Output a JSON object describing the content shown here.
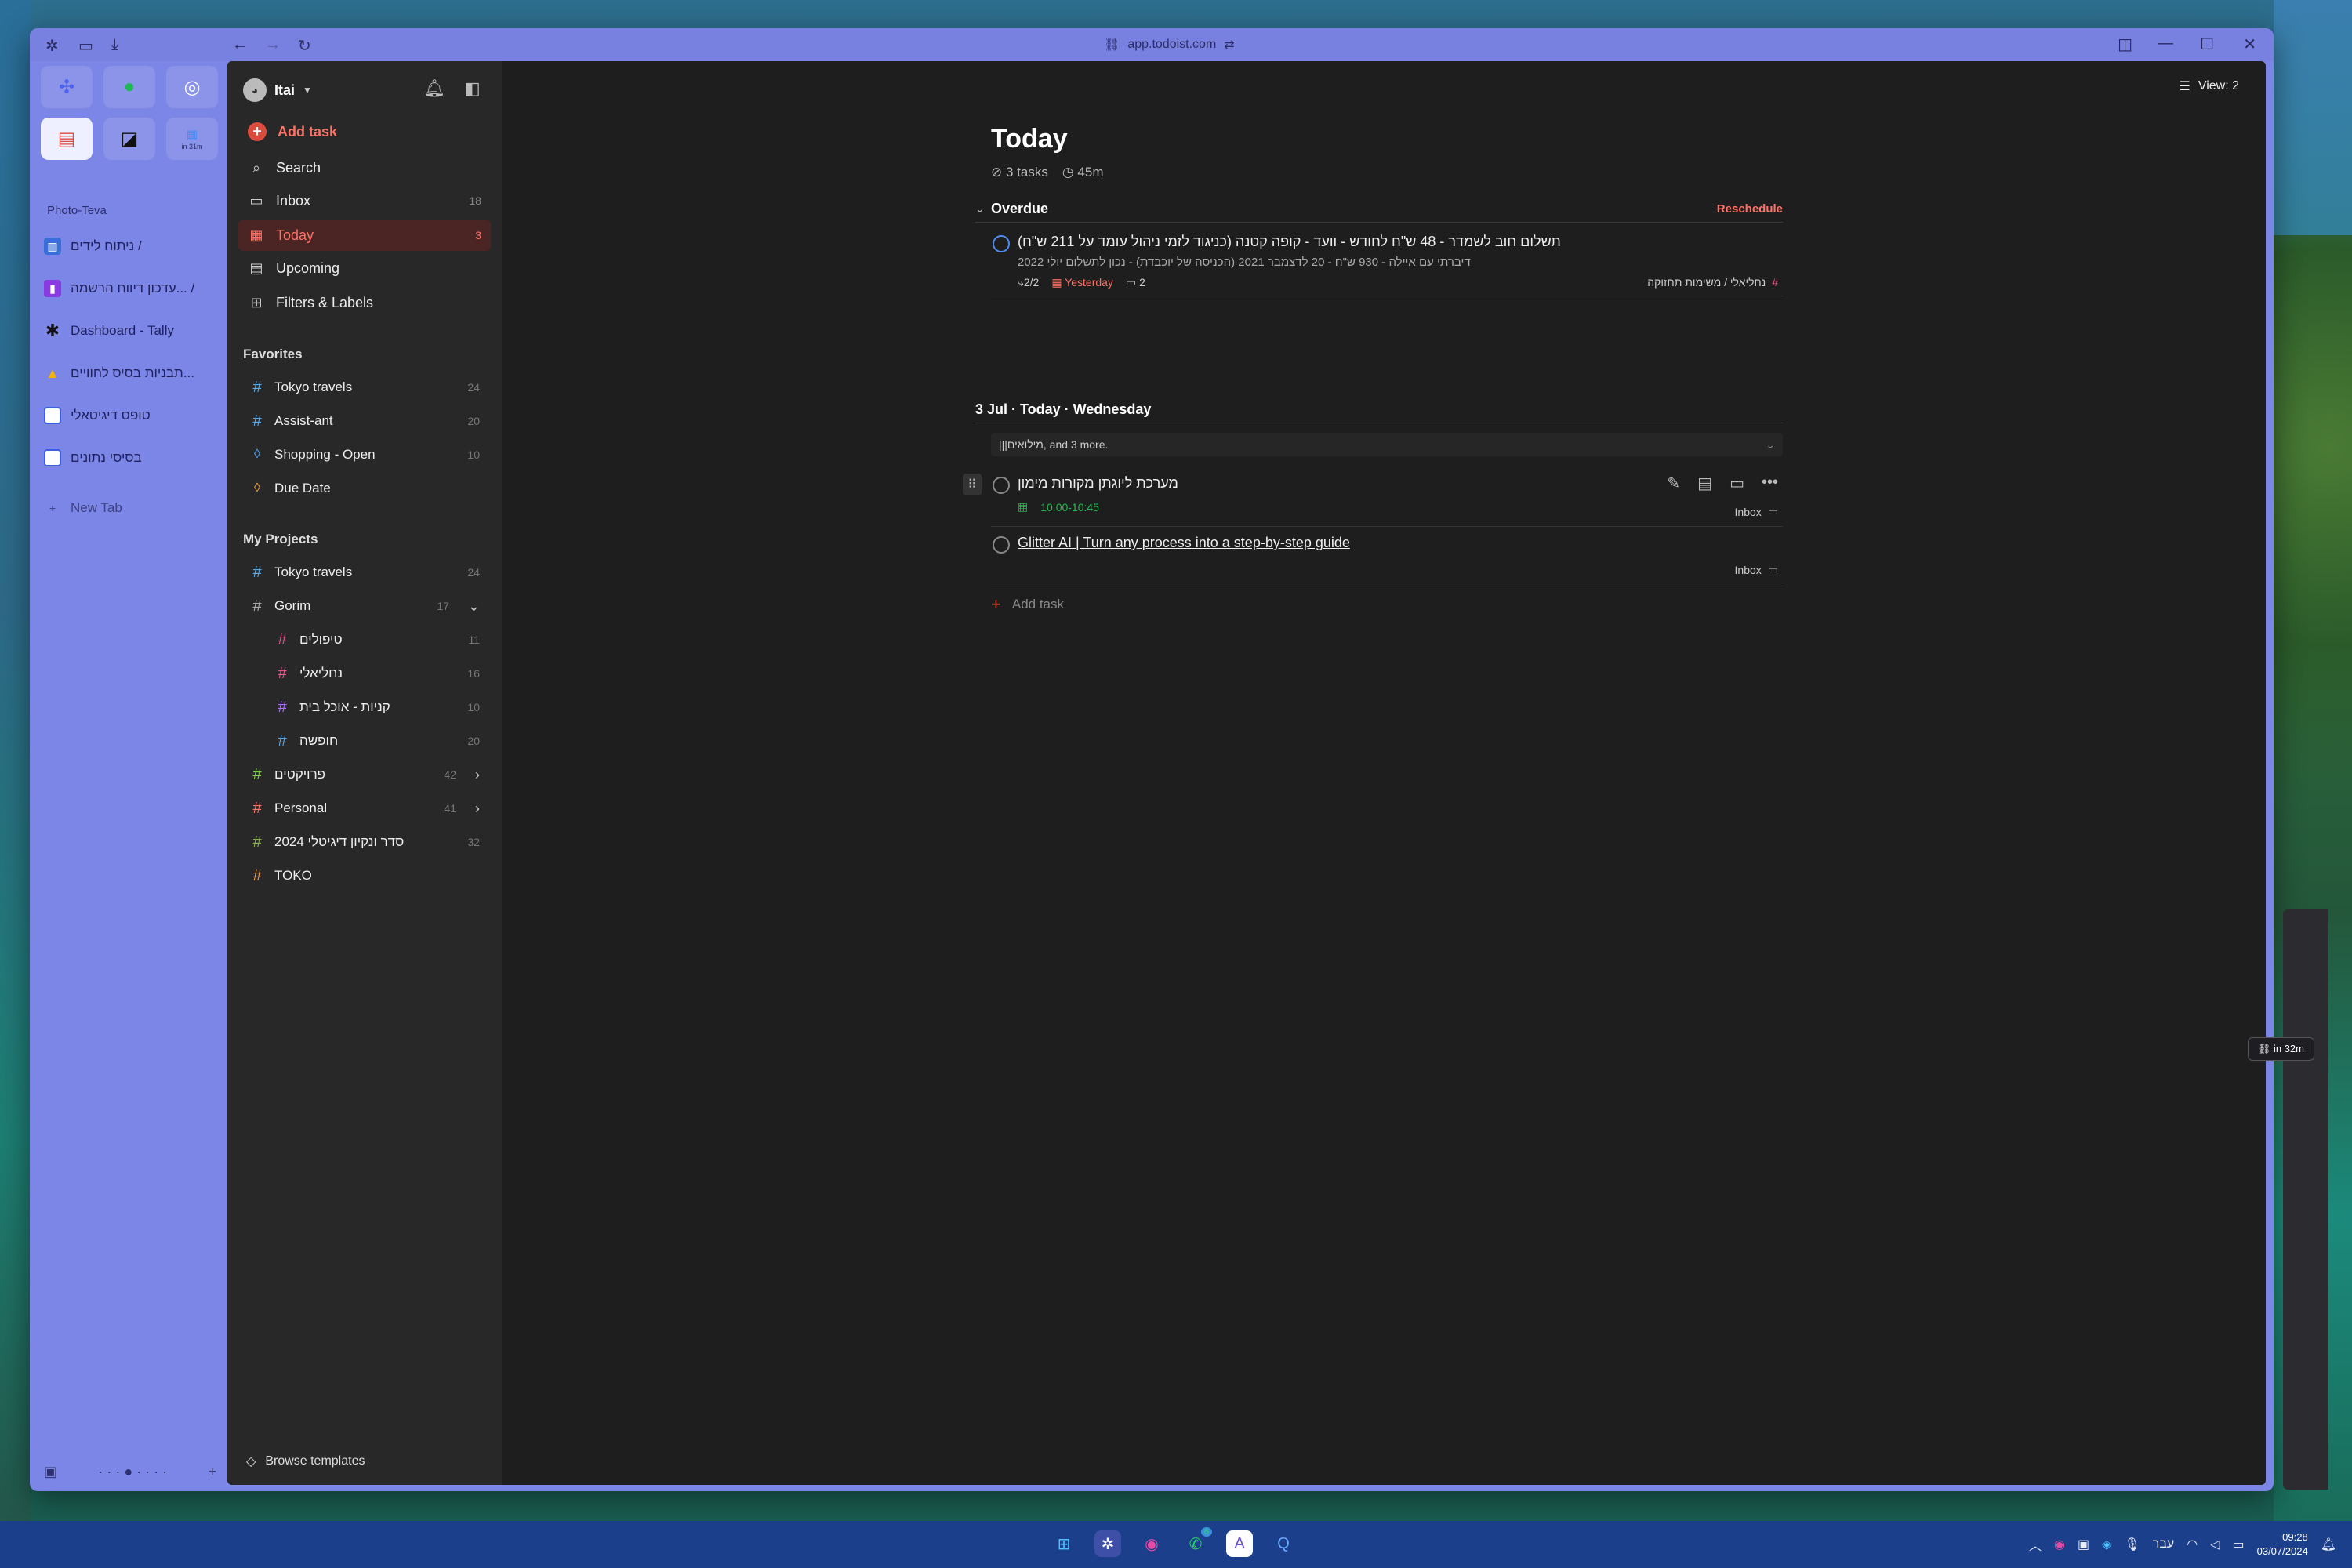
{
  "browser": {
    "url": "app.todoist.com",
    "space_label": "Photo-Teva",
    "fav_badge": "in 31m",
    "new_tab_label": "New Tab",
    "tabs": [
      {
        "label": "ניתוח לידים / ",
        "icon": "chart-icon"
      },
      {
        "label": "עדכון דיווח הרשמה... / ",
        "icon": "file-icon"
      },
      {
        "label": "Dashboard - Tally",
        "icon": "asterisk-icon"
      },
      {
        "label": "תבניות בסיס לחוויים...",
        "icon": "drive-icon"
      },
      {
        "label": "טופס דיגיטאלי",
        "icon": "form-icon"
      },
      {
        "label": "בסיסי נתונים",
        "icon": "form-icon"
      }
    ]
  },
  "sidebar": {
    "user": "Itai",
    "add_task": "Add task",
    "nav": [
      {
        "label": "Search",
        "count": ""
      },
      {
        "label": "Inbox",
        "count": "18"
      },
      {
        "label": "Today",
        "count": "3"
      },
      {
        "label": "Upcoming",
        "count": ""
      },
      {
        "label": "Filters & Labels",
        "count": ""
      }
    ],
    "favorites_title": "Favorites",
    "favorites": [
      {
        "label": "Tokyo travels",
        "count": "24",
        "color": "#5aa9e6"
      },
      {
        "label": "Assist-ant",
        "count": "20",
        "color": "#5aa9e6"
      },
      {
        "label": "Shopping - Open",
        "count": "10",
        "color": "#4fa3f7"
      },
      {
        "label": "Due Date",
        "count": "",
        "color": "#f0a03c"
      }
    ],
    "projects_title": "My Projects",
    "projects": [
      {
        "label": "Tokyo travels",
        "count": "24",
        "color": "#5aa9e6"
      },
      {
        "label": "Gorim",
        "count": "17",
        "color": "#aaa"
      },
      {
        "label": "טיפולים",
        "count": "11",
        "color": "#e9548d"
      },
      {
        "label": "נחליאלי",
        "count": "16",
        "color": "#e9548d"
      },
      {
        "label": "קניות - אוכל בית",
        "count": "10",
        "color": "#a970ff"
      },
      {
        "label": "חופשה",
        "count": "20",
        "color": "#5aa9e6"
      },
      {
        "label": "פרויקטים",
        "count": "42",
        "color": "#7ecc49"
      },
      {
        "label": "Personal",
        "count": "41",
        "color": "#ff7066"
      },
      {
        "label": "2024 סדר ונקיון דיגיטלי",
        "count": "32",
        "color": "#8ab04a"
      },
      {
        "label": "TOKO",
        "count": "",
        "color": "#f0a03c"
      }
    ],
    "browse_templates": "Browse templates"
  },
  "main": {
    "view_label": "View: 2",
    "title": "Today",
    "tasks_meta": "3 tasks",
    "time_meta": "45m",
    "overdue_title": "Overdue",
    "reschedule": "Reschedule",
    "overdue_task": {
      "title": "תשלום חוב לשמדר - 48 ש\"ח לחודש - וועד - קופה קטנה (כניגוד לזמי ניהול עומד על 211 ש\"ח)",
      "desc": "דיברתי עם איילה - 930 ש\"ח - 20 לדצמבר 2021 (הכניסה של יוכבדת) - נכון לתשלום יולי 2022",
      "subtasks": "2/2",
      "date": "Yesterday",
      "comments": "2",
      "project": "נחליאלי / משימות תחזוקה"
    },
    "day_title": "3 Jul · Today · Wednesday",
    "collapsed_text": "|||מילואים, and 3 more.",
    "task1": {
      "title": "מערכת ליוגתן מקורות מימון",
      "time": "10:00-10:45",
      "project": "Inbox"
    },
    "task2": {
      "title": "Glitter AI | Turn any process into a step-by-step guide",
      "project": "Inbox"
    },
    "add_task": "Add task",
    "float_badge": "in 32m"
  },
  "taskbar": {
    "lang": "עבר",
    "time": "09:28",
    "date": "03/07/2024",
    "whatsapp_badge": "6"
  }
}
